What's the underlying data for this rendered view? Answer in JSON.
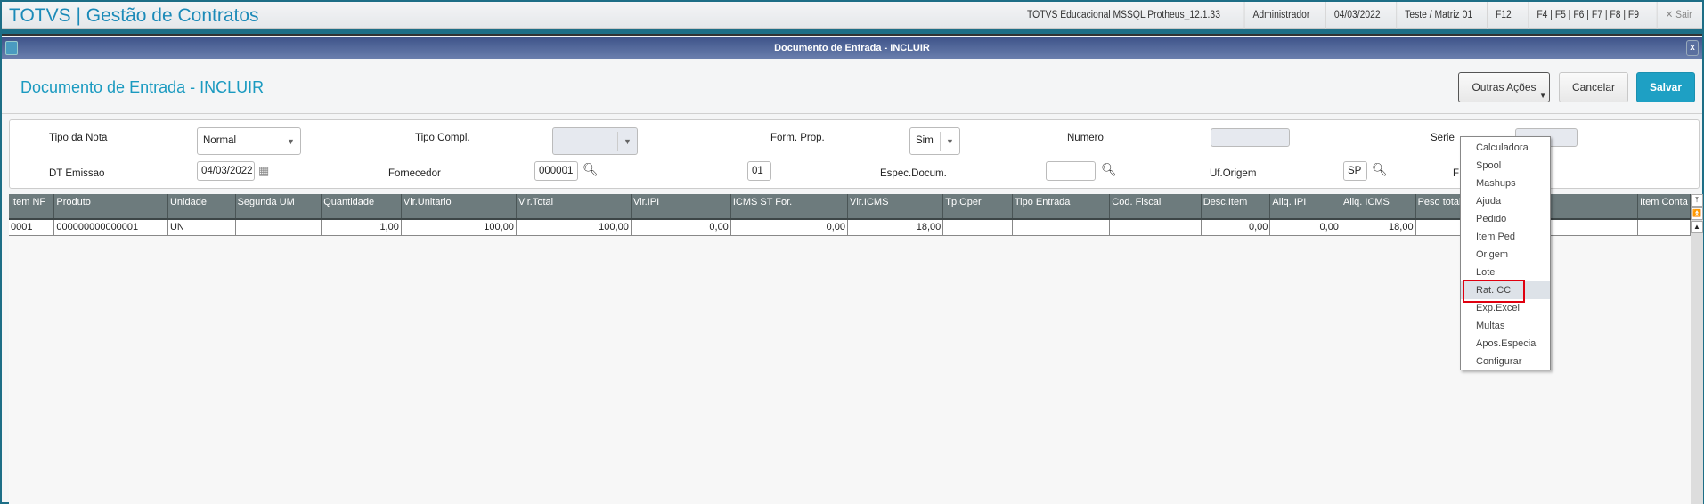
{
  "header": {
    "app_title": "TOTVS | Gestão de Contratos",
    "env": "TOTVS Educacional MSSQL Protheus_12.1.33",
    "user": "Administrador",
    "date": "04/03/2022",
    "branch": "Teste / Matriz 01",
    "f12": "F12",
    "fkeys": "F4 | F5 | F6 | F7 | F8 | F9",
    "exit": "✕ Sair"
  },
  "dialog": {
    "title": "Documento de Entrada - INCLUIR",
    "close": "x",
    "page_title": "Documento de Entrada - INCLUIR"
  },
  "toolbar": {
    "other_actions": "Outras Ações",
    "cancel": "Cancelar",
    "save": "Salvar"
  },
  "form": {
    "tipo_nota": {
      "label": "Tipo da Nota",
      "value": "Normal"
    },
    "tipo_compl": {
      "label": "Tipo Compl.",
      "value": ""
    },
    "form_prop": {
      "label": "Form. Prop.",
      "value": "Sim"
    },
    "numero": {
      "label": "Numero",
      "value": ""
    },
    "serie": {
      "label": "Serie",
      "value": ""
    },
    "dt_emissao": {
      "label": "DT Emissao",
      "value": "04/03/2022"
    },
    "fornecedor": {
      "label": "Fornecedor",
      "value": "000001",
      "loja": "01"
    },
    "espec_docum": {
      "label": "Espec.Docum.",
      "value": ""
    },
    "uf_origem": {
      "label": "Uf.Origem",
      "value": "SP"
    },
    "cut_label": "F"
  },
  "grid": {
    "columns": [
      "Item NF",
      "Produto",
      "Unidade",
      "Segunda UM",
      "Quantidade",
      "Vlr.Unitario",
      "Vlr.Total",
      "Vlr.IPI",
      "ICMS ST For.",
      "Vlr.ICMS",
      "Tp.Oper",
      "Tipo Entrada",
      "Cod. Fiscal",
      "Desc.Item",
      "Aliq. IPI",
      "Aliq. ICMS",
      "Peso total",
      "Item Conta"
    ],
    "rows": [
      [
        "0001",
        "000000000000001",
        "UN",
        "",
        "1,00",
        "100,00",
        "100,00",
        "0,00",
        "0,00",
        "18,00",
        "",
        "",
        "",
        "0,00",
        "0,00",
        "18,00",
        "",
        ""
      ]
    ]
  },
  "menu": {
    "items": [
      "Calculadora",
      "Spool",
      "Mashups",
      "Ajuda",
      "Pedido",
      "Item Ped",
      "Origem",
      "Lote",
      "Rat. CC",
      "Exp.Excel",
      "Multas",
      "Apos.Especial",
      "Configurar"
    ],
    "highlighted": "Rat. CC"
  }
}
